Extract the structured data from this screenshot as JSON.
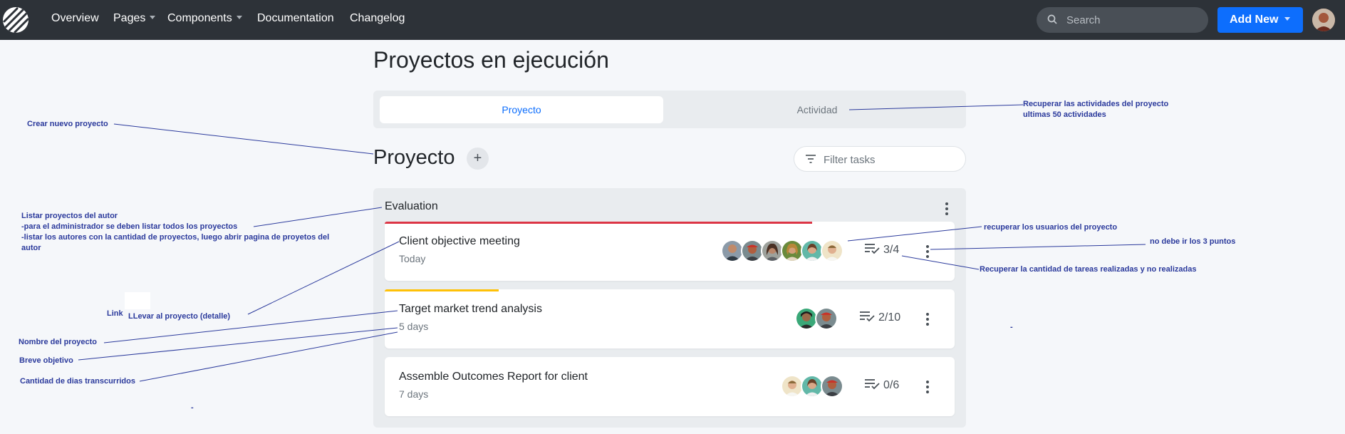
{
  "navbar": {
    "links": [
      "Overview",
      "Pages",
      "Components",
      "Documentation",
      "Changelog"
    ],
    "search_placeholder": "Search",
    "add_new_label": "Add New"
  },
  "page": {
    "title": "Proyectos en ejecución",
    "tabs": [
      {
        "label": "Proyecto",
        "active": true
      },
      {
        "label": "Actividad",
        "active": false
      }
    ],
    "section_title": "Proyecto",
    "add_button": "+",
    "filter_placeholder": "Filter tasks"
  },
  "board": {
    "title": "Evaluation",
    "cards": [
      {
        "name": "Client objective meeting",
        "sub": "Today",
        "tasks": "3/4",
        "bar_color": "#dc3545",
        "progress": 0.75,
        "users": 6
      },
      {
        "name": "Target market trend analysis",
        "sub": "5 days",
        "tasks": "2/10",
        "bar_color": "#ffc107",
        "progress": 0.2,
        "users": 2
      },
      {
        "name": "Assemble Outcomes Report for client",
        "sub": "7 days",
        "tasks": "0/6",
        "bar_color": "#e9ecef",
        "progress": 0,
        "users": 3
      }
    ]
  },
  "annotations": {
    "crear": "Crear nuevo proyecto",
    "actividades_1": "Recuperar las actividades del proyecto",
    "actividades_2": "ultimas 50 actividades",
    "listar_1": "Listar proyectos del autor",
    "listar_2": "-para el administrador se deben listar todos los proyectos",
    "listar_3": "-listar los autores con la cantidad de proyectos, luego abrir pagina de proyetos del",
    "listar_4": "autor",
    "usuarios": "recuperar los usuarios del proyecto",
    "puntos": "no debe ir los 3 puntos",
    "tareas": "Recuperar la cantidad de tareas realizadas y no realizadas",
    "link": "Link",
    "llevar": "LLevar al proyecto (detalle)",
    "nombre": "Nombre del proyecto",
    "objetivo": "Breve objetivo",
    "dias": "Cantidad de dias transcurridos",
    "dash_1": "-",
    "dash_2": "-"
  },
  "colors": {
    "navbar": "#2d3238",
    "primary": "#0d6efd",
    "annotation": "#2b3a9c"
  }
}
